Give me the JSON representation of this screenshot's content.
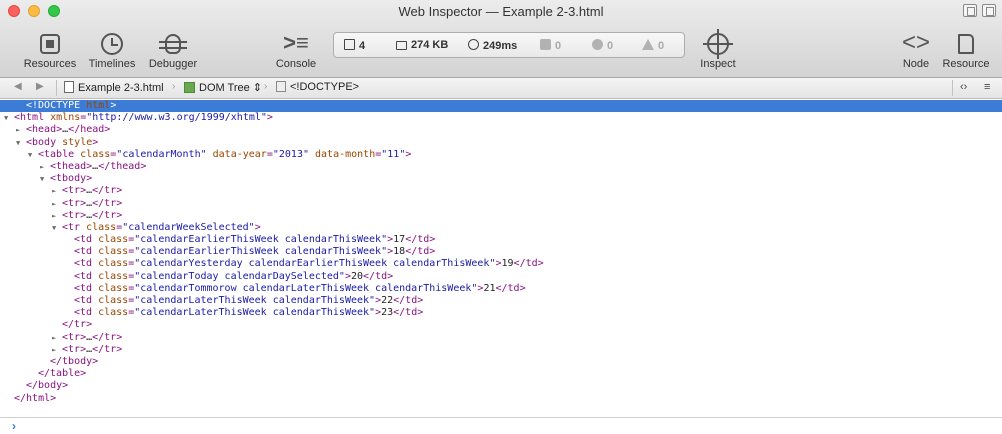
{
  "window": {
    "title": "Web Inspector — Example 2-3.html"
  },
  "toolbar": {
    "left": [
      {
        "label": "Resources",
        "icon": "resources-icon"
      },
      {
        "label": "Timelines",
        "icon": "timelines-icon"
      },
      {
        "label": "Debugger",
        "icon": "debugger-icon"
      }
    ],
    "console_label": "Console",
    "inspect_label": "Inspect",
    "node_label": "Node",
    "resource_label": "Resource"
  },
  "status": {
    "resources": "4",
    "size": "274 KB",
    "time": "249ms",
    "logs": "0",
    "errors": "0",
    "warnings": "0"
  },
  "breadcrumb": {
    "file": "Example 2-3.html",
    "view": "DOM Tree",
    "node": "<!DOCTYPE>"
  },
  "dom_lines": [
    {
      "indent": 1,
      "tri": "",
      "selected": true,
      "text": "<!DOCTYPE html>"
    },
    {
      "indent": 0,
      "tri": "▼",
      "selected": false,
      "text": "<html xmlns=\"http://www.w3.org/1999/xhtml\">"
    },
    {
      "indent": 1,
      "tri": "►",
      "selected": false,
      "text": "<head>…</head>"
    },
    {
      "indent": 1,
      "tri": "▼",
      "selected": false,
      "text": "<body style>"
    },
    {
      "indent": 2,
      "tri": "▼",
      "selected": false,
      "text": "<table class=\"calendarMonth\" data-year=\"2013\" data-month=\"11\">"
    },
    {
      "indent": 3,
      "tri": "►",
      "selected": false,
      "text": "<thead>…</thead>"
    },
    {
      "indent": 3,
      "tri": "▼",
      "selected": false,
      "text": "<tbody>"
    },
    {
      "indent": 4,
      "tri": "►",
      "selected": false,
      "text": "<tr>…</tr>"
    },
    {
      "indent": 4,
      "tri": "►",
      "selected": false,
      "text": "<tr>…</tr>"
    },
    {
      "indent": 4,
      "tri": "►",
      "selected": false,
      "text": "<tr>…</tr>"
    },
    {
      "indent": 4,
      "tri": "▼",
      "selected": false,
      "text": "<tr class=\"calendarWeekSelected\">"
    },
    {
      "indent": 5,
      "tri": "",
      "selected": false,
      "text": "<td class=\"calendarEarlierThisWeek calendarThisWeek\">17</td>"
    },
    {
      "indent": 5,
      "tri": "",
      "selected": false,
      "text": "<td class=\"calendarEarlierThisWeek calendarThisWeek\">18</td>"
    },
    {
      "indent": 5,
      "tri": "",
      "selected": false,
      "text": "<td class=\"calendarYesterday calendarEarlierThisWeek calendarThisWeek\">19</td>"
    },
    {
      "indent": 5,
      "tri": "",
      "selected": false,
      "text": "<td class=\"calendarToday calendarDaySelected\">20</td>"
    },
    {
      "indent": 5,
      "tri": "",
      "selected": false,
      "text": "<td class=\"calendarTommorow calendarLaterThisWeek calendarThisWeek\">21</td>"
    },
    {
      "indent": 5,
      "tri": "",
      "selected": false,
      "text": "<td class=\"calendarLaterThisWeek calendarThisWeek\">22</td>"
    },
    {
      "indent": 5,
      "tri": "",
      "selected": false,
      "text": "<td class=\"calendarLaterThisWeek calendarThisWeek\">23</td>"
    },
    {
      "indent": 4,
      "tri": "",
      "selected": false,
      "text": "</tr>"
    },
    {
      "indent": 4,
      "tri": "►",
      "selected": false,
      "text": "<tr>…</tr>"
    },
    {
      "indent": 4,
      "tri": "►",
      "selected": false,
      "text": "<tr>…</tr>"
    },
    {
      "indent": 3,
      "tri": "",
      "selected": false,
      "text": "</tbody>"
    },
    {
      "indent": 2,
      "tri": "",
      "selected": false,
      "text": "</table>"
    },
    {
      "indent": 1,
      "tri": "",
      "selected": false,
      "text": "</body>"
    },
    {
      "indent": 0,
      "tri": "",
      "selected": false,
      "text": "</html>"
    }
  ],
  "console": {
    "prompt": "›"
  }
}
